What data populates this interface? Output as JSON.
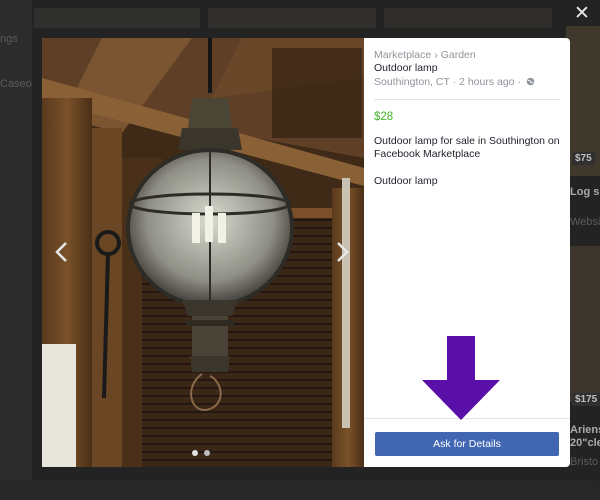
{
  "background": {
    "left_label_1": "ngs",
    "left_label_2": "Caseo",
    "right_label_1": "Log sp",
    "right_label_2": "Websit",
    "right_label_3": "Ariens",
    "right_label_4": "20\"cle",
    "right_label_5": "Bristo",
    "badge_1": "$75",
    "badge_2": "$175"
  },
  "listing": {
    "breadcrumb": {
      "category": "Marketplace",
      "separator": "›",
      "subcategory": "Garden"
    },
    "title": "Outdoor lamp",
    "location": "Southington, CT",
    "time_posted": "2 hours ago",
    "meta_separator": "·",
    "price": "$28",
    "description": "Outdoor lamp for sale in Southington on Facebook Marketplace",
    "description_extra": "Outdoor lamp",
    "ask_button_label": "Ask for Details"
  },
  "controls": {
    "close_glyph": "✕",
    "photo_count": 2,
    "active_photo": 1
  },
  "colors": {
    "price_green": "#42b72a",
    "button_blue": "#4267b2",
    "arrow_purple": "#5a0fa8",
    "muted_text": "#90949c"
  },
  "icons": {
    "close": "close-icon",
    "prev": "chevron-left-icon",
    "next": "chevron-right-icon",
    "globe": "globe-icon",
    "arrow": "arrow-down-icon"
  }
}
